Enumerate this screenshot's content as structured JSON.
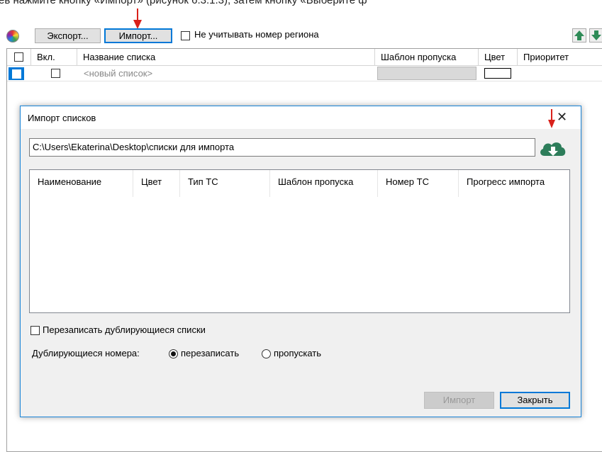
{
  "doc_caption": "ев нажмите кнопку «Импорт» (рисунок 6.3.1.3), затем кнопку «Выберите ф",
  "toolbar": {
    "export_label": "Экспорт...",
    "import_label": "Импорт...",
    "ignore_region_label": "Не учитывать номер региона",
    "ignore_region_checked": false
  },
  "grid": {
    "columns": [
      "Вкл.",
      "Название списка",
      "Шаблон пропуска",
      "Цвет",
      "Приоритет"
    ],
    "new_row_placeholder": "<новый список>"
  },
  "dialog": {
    "title": "Импорт списков",
    "close_glyph": "✕",
    "path": "C:\\Users\\Ekaterina\\Desktop\\списки для импорта",
    "table_columns": [
      "Наименование",
      "Цвет",
      "Тип ТС",
      "Шаблон пропуска",
      "Номер ТС",
      "Прогресс импорта"
    ],
    "overwrite_label": "Перезаписать дублирующиеся списки",
    "overwrite_checked": false,
    "dup_numbers_label": "Дублирующиеся номера:",
    "radio_overwrite": "перезаписать",
    "radio_skip": "пропускать",
    "selected_option": "перезаписать",
    "import_button": "Импорт",
    "close_button": "Закрыть"
  },
  "icons": {
    "color_palette": "color-palette-icon",
    "move_up": "arrow-up-icon",
    "move_down": "arrow-down-icon",
    "cloud_download": "cloud-download-icon",
    "annotation_arrow": "red-arrow-icon"
  },
  "colors": {
    "accent": "#0078d7",
    "green": "#2e8b57",
    "cloud": "#2d7d5a",
    "annotation": "#d9211b"
  }
}
